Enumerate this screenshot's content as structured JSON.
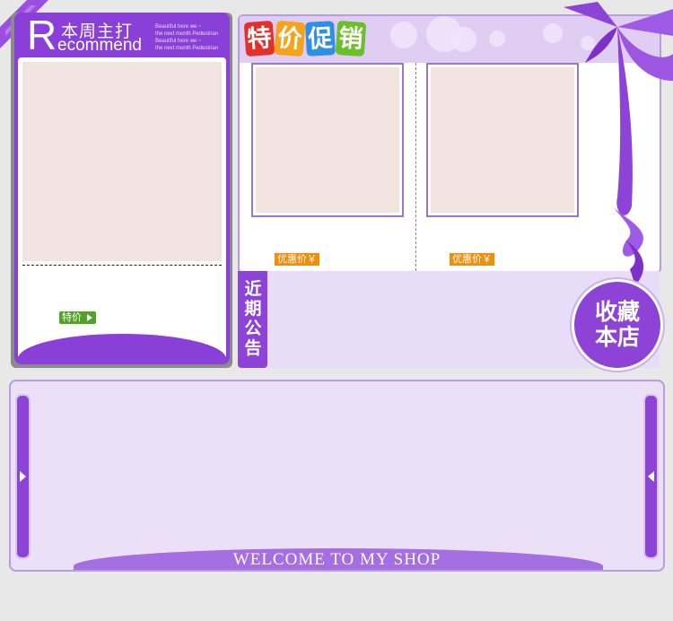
{
  "recommend": {
    "initial": "R",
    "title_cn": "本周主打",
    "title_en": "ecommend",
    "tagline": [
      "Beautiful here we ~",
      "the next month Pedestrian",
      "Beautiful here we ~",
      "the next month Pedestrian"
    ],
    "special_label": "特价"
  },
  "promo": {
    "title_chars": [
      "特",
      "价",
      "促",
      "销"
    ],
    "title_colors": [
      "#e2312a",
      "#f6a21a",
      "#2f8fe3",
      "#6bbf2b"
    ],
    "price_labels": [
      "优惠价￥",
      "优惠价￥"
    ]
  },
  "notice": {
    "label_chars": [
      "近",
      "期",
      "公",
      "告"
    ]
  },
  "favorite": {
    "line1": "收藏",
    "line2": "本店"
  },
  "welcome": {
    "text": "WELCOME TO MY SHOP"
  },
  "colors": {
    "accent": "#8a3fd8",
    "light": "#ecdff8",
    "photo_placeholder": "#f3e4e2",
    "button_green": "#4fa326",
    "price_orange": "#ef8e0c"
  }
}
